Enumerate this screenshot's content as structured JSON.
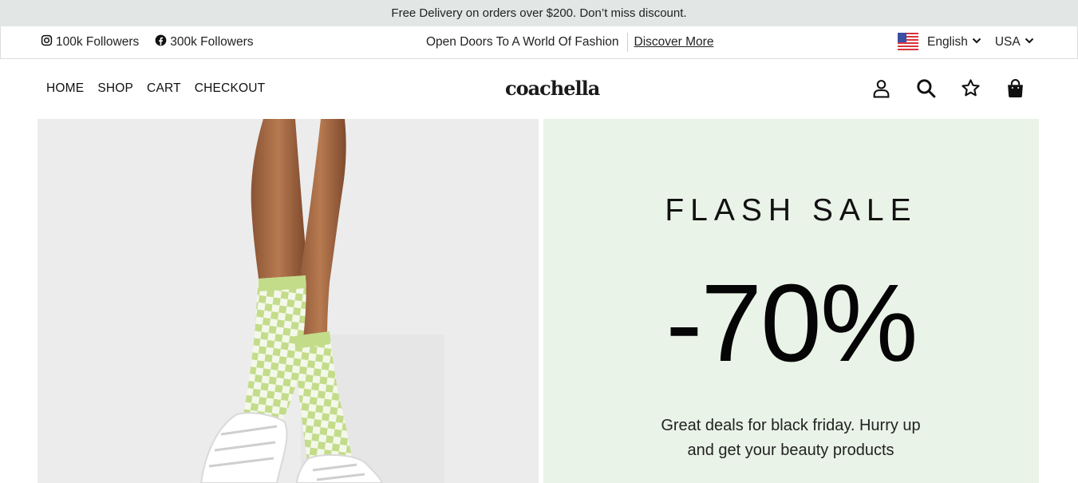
{
  "announcement": "Free Delivery on orders over $200. Don’t miss discount.",
  "infobar": {
    "instagram": {
      "icon": "instagram-icon",
      "label": "100k Followers"
    },
    "facebook": {
      "icon": "facebook-icon",
      "label": "300k Followers"
    },
    "promo_text": "Open Doors To A World Of Fashion",
    "promo_link": "Discover More",
    "language": "English",
    "country": "USA"
  },
  "nav": {
    "menu": [
      "HOME",
      "SHOP",
      "CART",
      "CHECKOUT"
    ],
    "logo": "coachella",
    "icons": [
      "user-icon",
      "search-icon",
      "star-icon",
      "shopping-bag-icon"
    ]
  },
  "hero": {
    "image": "model-legs-checkered-socks",
    "headline": "FLASH SALE",
    "discount": "-70%",
    "description": "Great deals for black friday. Hurry up and get your beauty products"
  },
  "colors": {
    "announcement_bg": "#e2e7e6",
    "hero_right_bg": "#eaf3e7",
    "sock_green": "#c3dc8a"
  }
}
